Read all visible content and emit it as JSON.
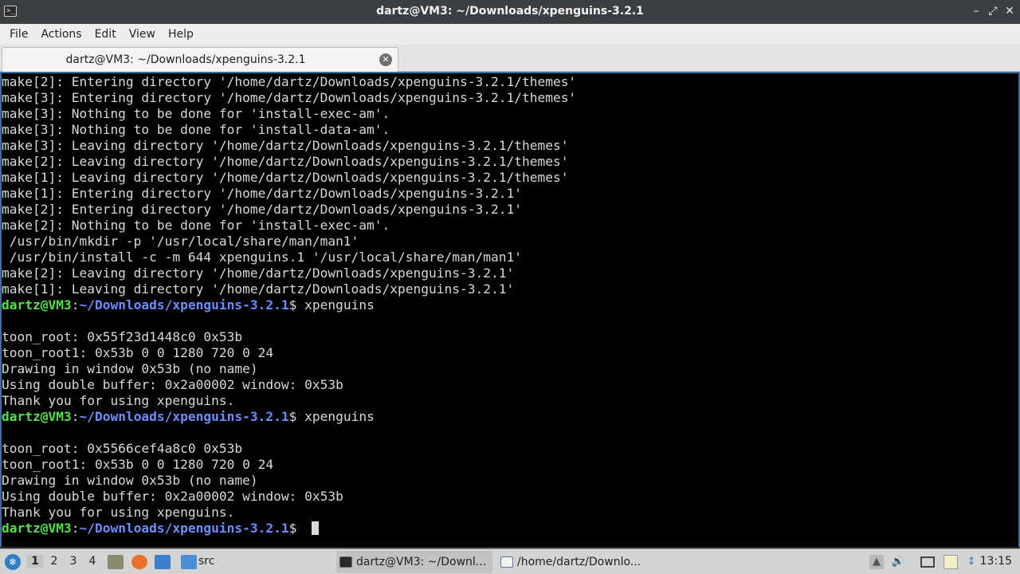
{
  "window": {
    "title": "dartz@VM3: ~/Downloads/xpenguins-3.2.1",
    "app_icon_glyph": ">_",
    "minimize_glyph": "–",
    "maximize_glyph": "⤢",
    "close_glyph": "✕"
  },
  "menu": {
    "file": "File",
    "actions": "Actions",
    "edit": "Edit",
    "view": "View",
    "help": "Help"
  },
  "tab": {
    "label": "dartz@VM3: ~/Downloads/xpenguins-3.2.1",
    "close_glyph": "✕"
  },
  "terminal": {
    "lines": [
      "make[2]: Entering directory '/home/dartz/Downloads/xpenguins-3.2.1/themes'",
      "make[3]: Entering directory '/home/dartz/Downloads/xpenguins-3.2.1/themes'",
      "make[3]: Nothing to be done for 'install-exec-am'.",
      "make[3]: Nothing to be done for 'install-data-am'.",
      "make[3]: Leaving directory '/home/dartz/Downloads/xpenguins-3.2.1/themes'",
      "make[2]: Leaving directory '/home/dartz/Downloads/xpenguins-3.2.1/themes'",
      "make[1]: Leaving directory '/home/dartz/Downloads/xpenguins-3.2.1/themes'",
      "make[1]: Entering directory '/home/dartz/Downloads/xpenguins-3.2.1'",
      "make[2]: Entering directory '/home/dartz/Downloads/xpenguins-3.2.1'",
      "make[2]: Nothing to be done for 'install-exec-am'.",
      " /usr/bin/mkdir -p '/usr/local/share/man/man1'",
      " /usr/bin/install -c -m 644 xpenguins.1 '/usr/local/share/man/man1'",
      "make[2]: Leaving directory '/home/dartz/Downloads/xpenguins-3.2.1'",
      "make[1]: Leaving directory '/home/dartz/Downloads/xpenguins-3.2.1'"
    ],
    "prompt": {
      "user": "dartz@VM3",
      "sep": ":",
      "path": "~/Downloads/xpenguins-3.2.1",
      "symbol": "$ "
    },
    "command1": "xpenguins",
    "output1": [
      "",
      "toon_root: 0x55f23d1448c0 0x53b",
      "toon_root1: 0x53b 0 0 1280 720 0 24",
      "Drawing in window 0x53b (no name)",
      "Using double buffer: 0x2a00002 window: 0x53b",
      "Thank you for using xpenguins."
    ],
    "command2": "xpenguins",
    "output2": [
      "",
      "toon_root: 0x5566cef4a8c0 0x53b",
      "toon_root1: 0x53b 0 0 1280 720 0 24",
      "Drawing in window 0x53b (no name)",
      "Using double buffer: 0x2a00002 window: 0x53b",
      "Thank you for using xpenguins."
    ],
    "colors": {
      "background": "#000000",
      "text": "#d8d8d8",
      "prompt_user": "#55e04a",
      "prompt_path": "#6f8dff"
    }
  },
  "taskbar": {
    "workspaces": [
      "1",
      "2",
      "3",
      "4"
    ],
    "active_workspace": "1",
    "launchers": [
      "file-manager-icon",
      "firefox-icon",
      "desktop-icon",
      "folder-icon"
    ],
    "folder_label": "src",
    "tasks": [
      {
        "label": "dartz@VM3: ~/Downl...",
        "icon": "terminal-icon",
        "active": true
      },
      {
        "label": "/home/dartz/Downlo...",
        "icon": "text-editor-icon",
        "active": false
      }
    ],
    "tray": [
      "up-arrow-icon",
      "volume-icon",
      "monitor-icon",
      "clipboard-icon",
      "network-icon"
    ],
    "clock": "13:15"
  }
}
